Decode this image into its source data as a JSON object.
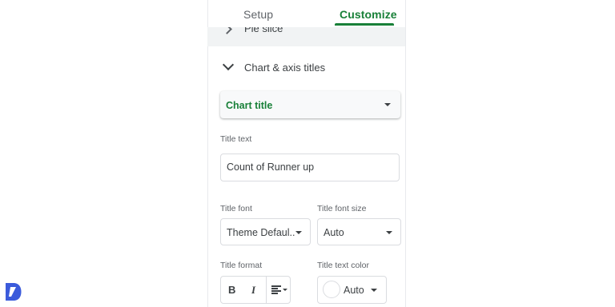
{
  "tabs": [
    {
      "label": "Setup",
      "active": false
    },
    {
      "label": "Customize",
      "active": true
    }
  ],
  "accent_color": "#188038",
  "collapsed_section": {
    "label": "Pie slice",
    "icon": "chevron-right-icon"
  },
  "section": {
    "label": "Chart & axis titles",
    "expanded": true,
    "icon": "chevron-down-icon"
  },
  "title_type_select": {
    "value": "Chart title"
  },
  "title_text": {
    "label": "Title text",
    "value": "Count of Runner up"
  },
  "title_font": {
    "label": "Title font",
    "value": "Theme Defaul..."
  },
  "title_font_size": {
    "label": "Title font size",
    "value": "Auto"
  },
  "title_format": {
    "label": "Title format",
    "buttons": [
      "B",
      "I"
    ],
    "align_icon": "align-left-icon"
  },
  "title_text_color": {
    "label": "Title text color",
    "value": "Auto",
    "swatch": "#ffffff"
  },
  "brand_logo": {
    "icon": "brand-logo-icon",
    "color": "#3b5bdb"
  }
}
